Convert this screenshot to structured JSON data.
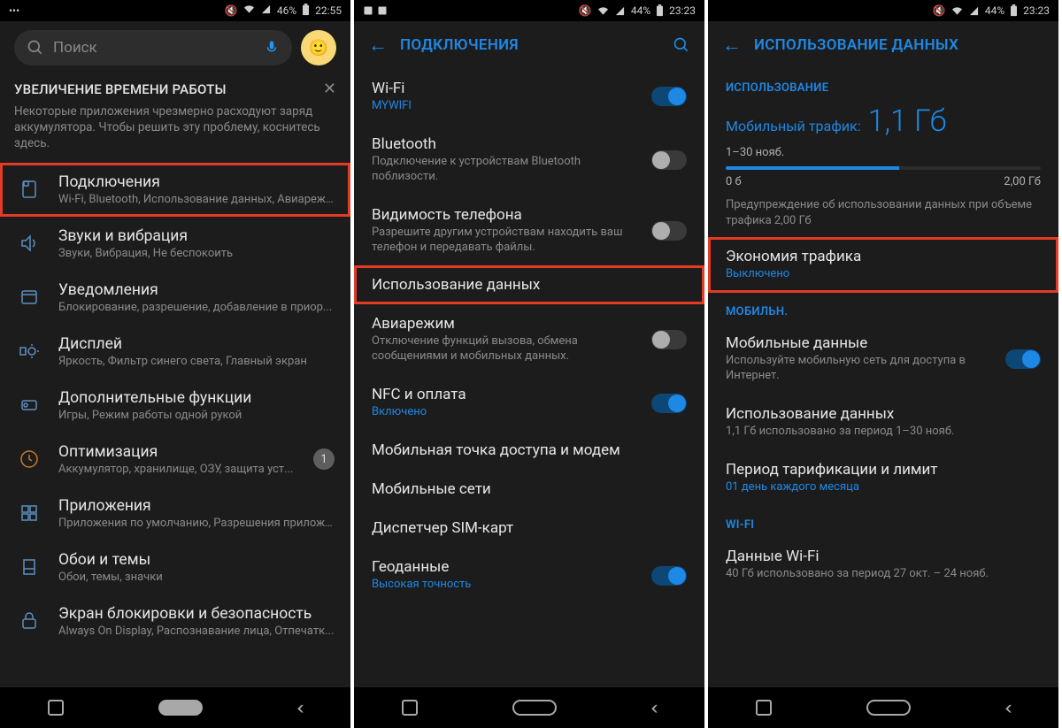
{
  "phone1": {
    "status": {
      "left": "•••",
      "battery": "46%",
      "time": "22:55"
    },
    "search_placeholder": "Поиск",
    "card": {
      "title": "УВЕЛИЧЕНИЕ ВРЕМЕНИ РАБОТЫ",
      "body": "Некоторые приложения чрезмерно расходуют заряд аккумулятора. Чтобы решить эту проблему, коснитесь здесь."
    },
    "items": [
      {
        "title": "Подключения",
        "sub": "Wi-Fi, Bluetooth, Использование данных, Авиареж..."
      },
      {
        "title": "Звуки и вибрация",
        "sub": "Звуки, Вибрация, Не беспокоить"
      },
      {
        "title": "Уведомления",
        "sub": "Блокирование, разрешение, добавление в приор..."
      },
      {
        "title": "Дисплей",
        "sub": "Яркость, Фильтр синего света, Главный экран"
      },
      {
        "title": "Дополнительные функции",
        "sub": "Игры, Режим работы одной рукой"
      },
      {
        "title": "Оптимизация",
        "sub": "Аккумулятор, хранилище, ОЗУ, защита уст...",
        "badge": "1"
      },
      {
        "title": "Приложения",
        "sub": "Приложения по умолчанию, Разрешения приложе..."
      },
      {
        "title": "Обои и темы",
        "sub": "Обои, темы, значки"
      },
      {
        "title": "Экран блокировки и безопасность",
        "sub": "Always On Display, Распознавание лица, Отпечатк..."
      }
    ]
  },
  "phone2": {
    "status": {
      "battery": "44%",
      "time": "23:23"
    },
    "header": "ПОДКЛЮЧЕНИЯ",
    "items": [
      {
        "title": "Wi-Fi",
        "sub": "MYWIFI",
        "subBlue": true,
        "toggle": "on"
      },
      {
        "title": "Bluetooth",
        "sub": "Подключение к устройствам Bluetooth поблизости.",
        "toggle": "off"
      },
      {
        "title": "Видимость телефона",
        "sub": "Разрешите другим устройствам находить ваш телефон и передавать файлы.",
        "toggle": "off"
      },
      {
        "title": "Использование данных"
      },
      {
        "title": "Авиарежим",
        "sub": "Отключение функций вызова, обмена сообщениями и мобильных данных.",
        "toggle": "off"
      },
      {
        "title": "NFC и оплата",
        "sub": "Включено",
        "subBlue": true,
        "toggle": "on"
      },
      {
        "title": "Мобильная точка доступа и модем"
      },
      {
        "title": "Мобильные сети"
      },
      {
        "title": "Диспетчер SIM-карт"
      },
      {
        "title": "Геоданные",
        "sub": "Высокая точность",
        "subBlue": true,
        "toggle": "on"
      }
    ]
  },
  "phone3": {
    "status": {
      "battery": "44%",
      "time": "23:23"
    },
    "header": "ИСПОЛЬЗОВАНИЕ ДАННЫХ",
    "section_usage": "ИСПОЛЬЗОВАНИЕ",
    "usage": {
      "label": "Мобильный трафик:",
      "value": "1,1 Гб",
      "period": "1–30 нояб.",
      "bar_left": "0 б",
      "bar_right": "2,00 Гб",
      "bar_fill_pct": 55,
      "note": "Предупреждение об использовании данных при объеме трафика 2,00 Гб"
    },
    "saver": {
      "title": "Экономия трафика",
      "sub": "Выключено"
    },
    "section_mobile": "МОБИЛЬН.",
    "mobile_items": [
      {
        "title": "Мобильные данные",
        "sub": "Используйте мобильную сеть для доступа в Интернет.",
        "toggle": "on"
      },
      {
        "title": "Использование данных",
        "sub": "1,1 Гб использовано за период 1–30 нояб."
      },
      {
        "title": "Период тарификации и лимит",
        "sub": "01 день каждого месяца",
        "subBlue": true
      }
    ],
    "section_wifi": "WI-FI",
    "wifi_items": [
      {
        "title": "Данные Wi-Fi",
        "sub": "40 Гб использовано за период 27 окт. – 24 нояб."
      }
    ]
  }
}
